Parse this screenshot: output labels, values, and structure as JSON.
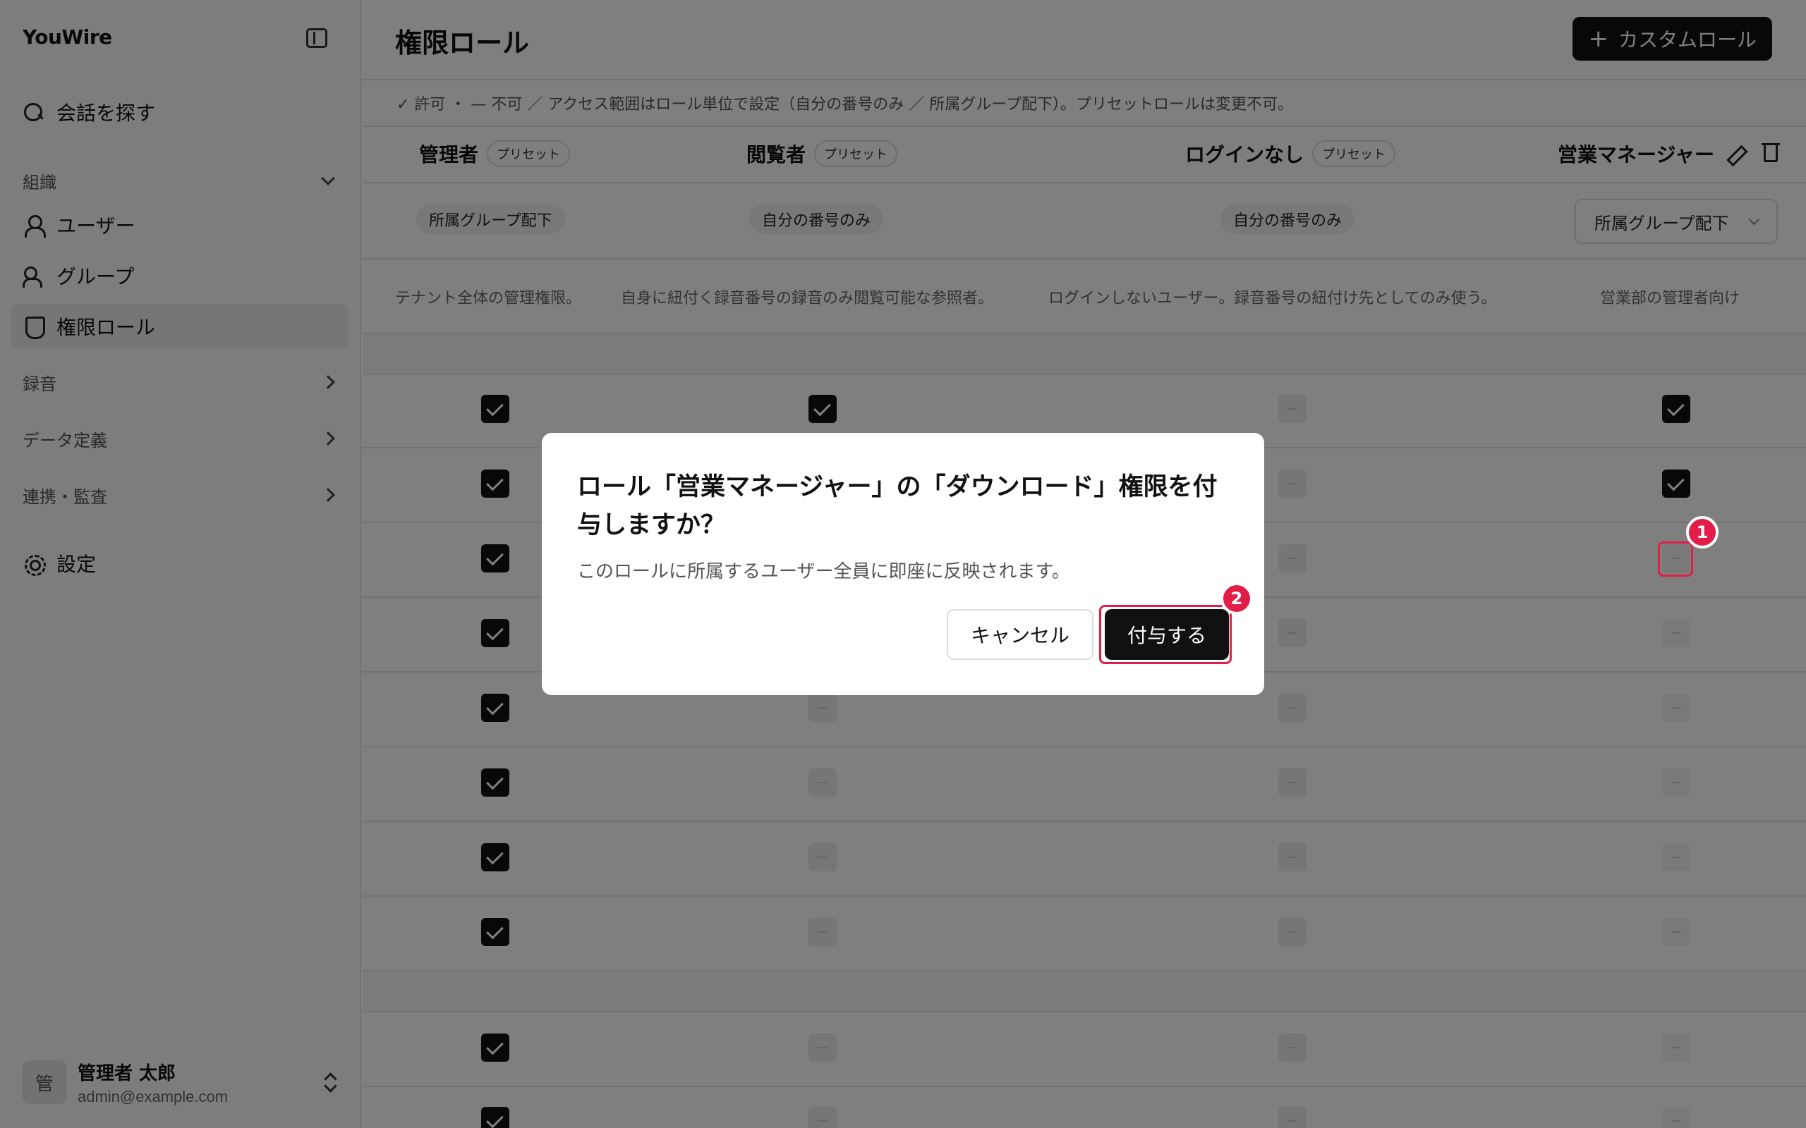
{
  "sidebar": {
    "brand": "YouWire",
    "search_label": "会話を探す",
    "org_label": "組織",
    "items": [
      "ユーザー",
      "グループ",
      "権限ロール"
    ],
    "groups": [
      "録音",
      "データ定義",
      "連携・監査"
    ],
    "settings_label": "設定",
    "user": {
      "avatar": "管",
      "name": "管理者 太郎",
      "email": "admin@example.com"
    }
  },
  "header": {
    "title": "権限ロール",
    "add_button": "カスタムロール",
    "add_icon": "+",
    "legend": "✓ 許可 ・ — 不可 ／ アクセス範囲はロール単位で設定（自分の番号のみ ／ 所属グループ配下）。プリセットロールは変更不可。"
  },
  "roles": [
    {
      "name": "管理者",
      "badge": "プリセット",
      "scope": "所属グループ配下",
      "description": "テナント全体の管理権限。"
    },
    {
      "name": "閲覧者",
      "badge": "プリセット",
      "scope": "自分の番号のみ",
      "description": "自身に紐付く録音番号の録音のみ閲覧可能な参照者。"
    },
    {
      "name": "ログインなし",
      "badge": "プリセット",
      "scope": "自分の番号のみ",
      "description": "ログインしないユーザー。録音番号の紐付け先としてのみ使う。"
    },
    {
      "name": "営業マネージャー",
      "badge": "",
      "scope": "所属グループ配下",
      "description": "営業部の管理者向け"
    }
  ],
  "modal": {
    "title": "ロール「営業マネージャー」の「ダウンロード」権限を付与しますか？",
    "body": "このロールに所属するユーザー全員に即座に反映されます。",
    "cancel": "キャンセル",
    "confirm": "付与する"
  },
  "markers": [
    "1",
    "2"
  ],
  "colors": {
    "accent": "#e11d48",
    "primary": "#111111"
  }
}
